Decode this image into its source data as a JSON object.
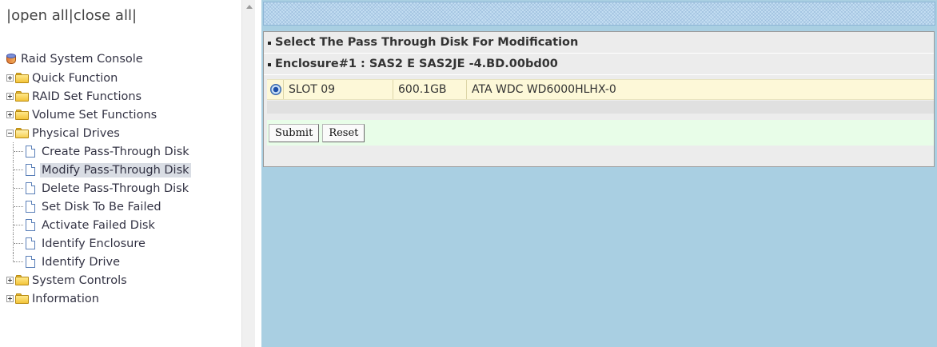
{
  "nav": {
    "open_all": "open all",
    "close_all": "close all",
    "separator": "|",
    "root_label": "Raid System Console",
    "root_icon": "raid-console-icon",
    "sections": [
      {
        "label": "Quick Function",
        "expanded": false
      },
      {
        "label": "RAID Set Functions",
        "expanded": false
      },
      {
        "label": "Volume Set Functions",
        "expanded": false
      },
      {
        "label": "Physical Drives",
        "expanded": true
      },
      {
        "label": "System Controls",
        "expanded": false
      },
      {
        "label": "Information",
        "expanded": false
      }
    ],
    "physical_drive_items": [
      {
        "label": "Create Pass-Through Disk"
      },
      {
        "label": "Modify Pass-Through Disk"
      },
      {
        "label": "Delete Pass-Through Disk"
      },
      {
        "label": "Set Disk To Be Failed"
      },
      {
        "label": "Activate Failed Disk"
      },
      {
        "label": "Identify Enclosure"
      },
      {
        "label": "Identify Drive"
      }
    ],
    "selected_item": "Modify Pass-Through Disk"
  },
  "main": {
    "panel_title": "Select The Pass Through Disk For Modification",
    "enclosure_title": "Enclosure#1 : SAS2 E SAS2JE -4.BD.00bd00",
    "drives": [
      {
        "slot": "SLOT 09",
        "size": "600.1GB",
        "model": "ATA WDC WD6000HLHX-0",
        "selected": true
      }
    ],
    "buttons": {
      "submit": "Submit",
      "reset": "Reset"
    }
  },
  "colors": {
    "content_bg": "#a9cfe2",
    "panel_bg": "#ececec",
    "drive_row_bg": "#fdf8d8",
    "button_row_bg": "#e8fde8"
  }
}
